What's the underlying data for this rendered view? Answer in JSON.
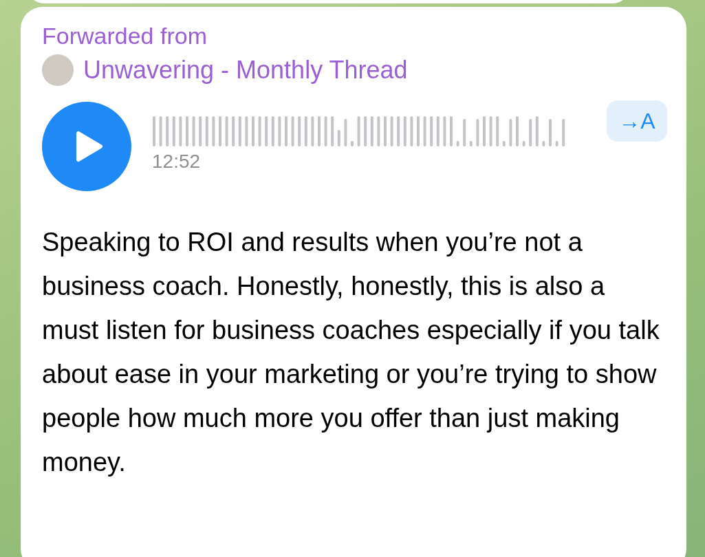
{
  "message": {
    "forwarded_label": "Forwarded from",
    "source_name": "Unwavering - Monthly Thread",
    "voice": {
      "duration": "12:52",
      "transcribe_label": "→A"
    },
    "text": "Speaking to ROI and results when you’re not a business coach. Honestly, honestly, this is also a must listen for business coaches especially if you talk about ease in your marketing or you’re trying to show people how much more you offer than just making money."
  }
}
